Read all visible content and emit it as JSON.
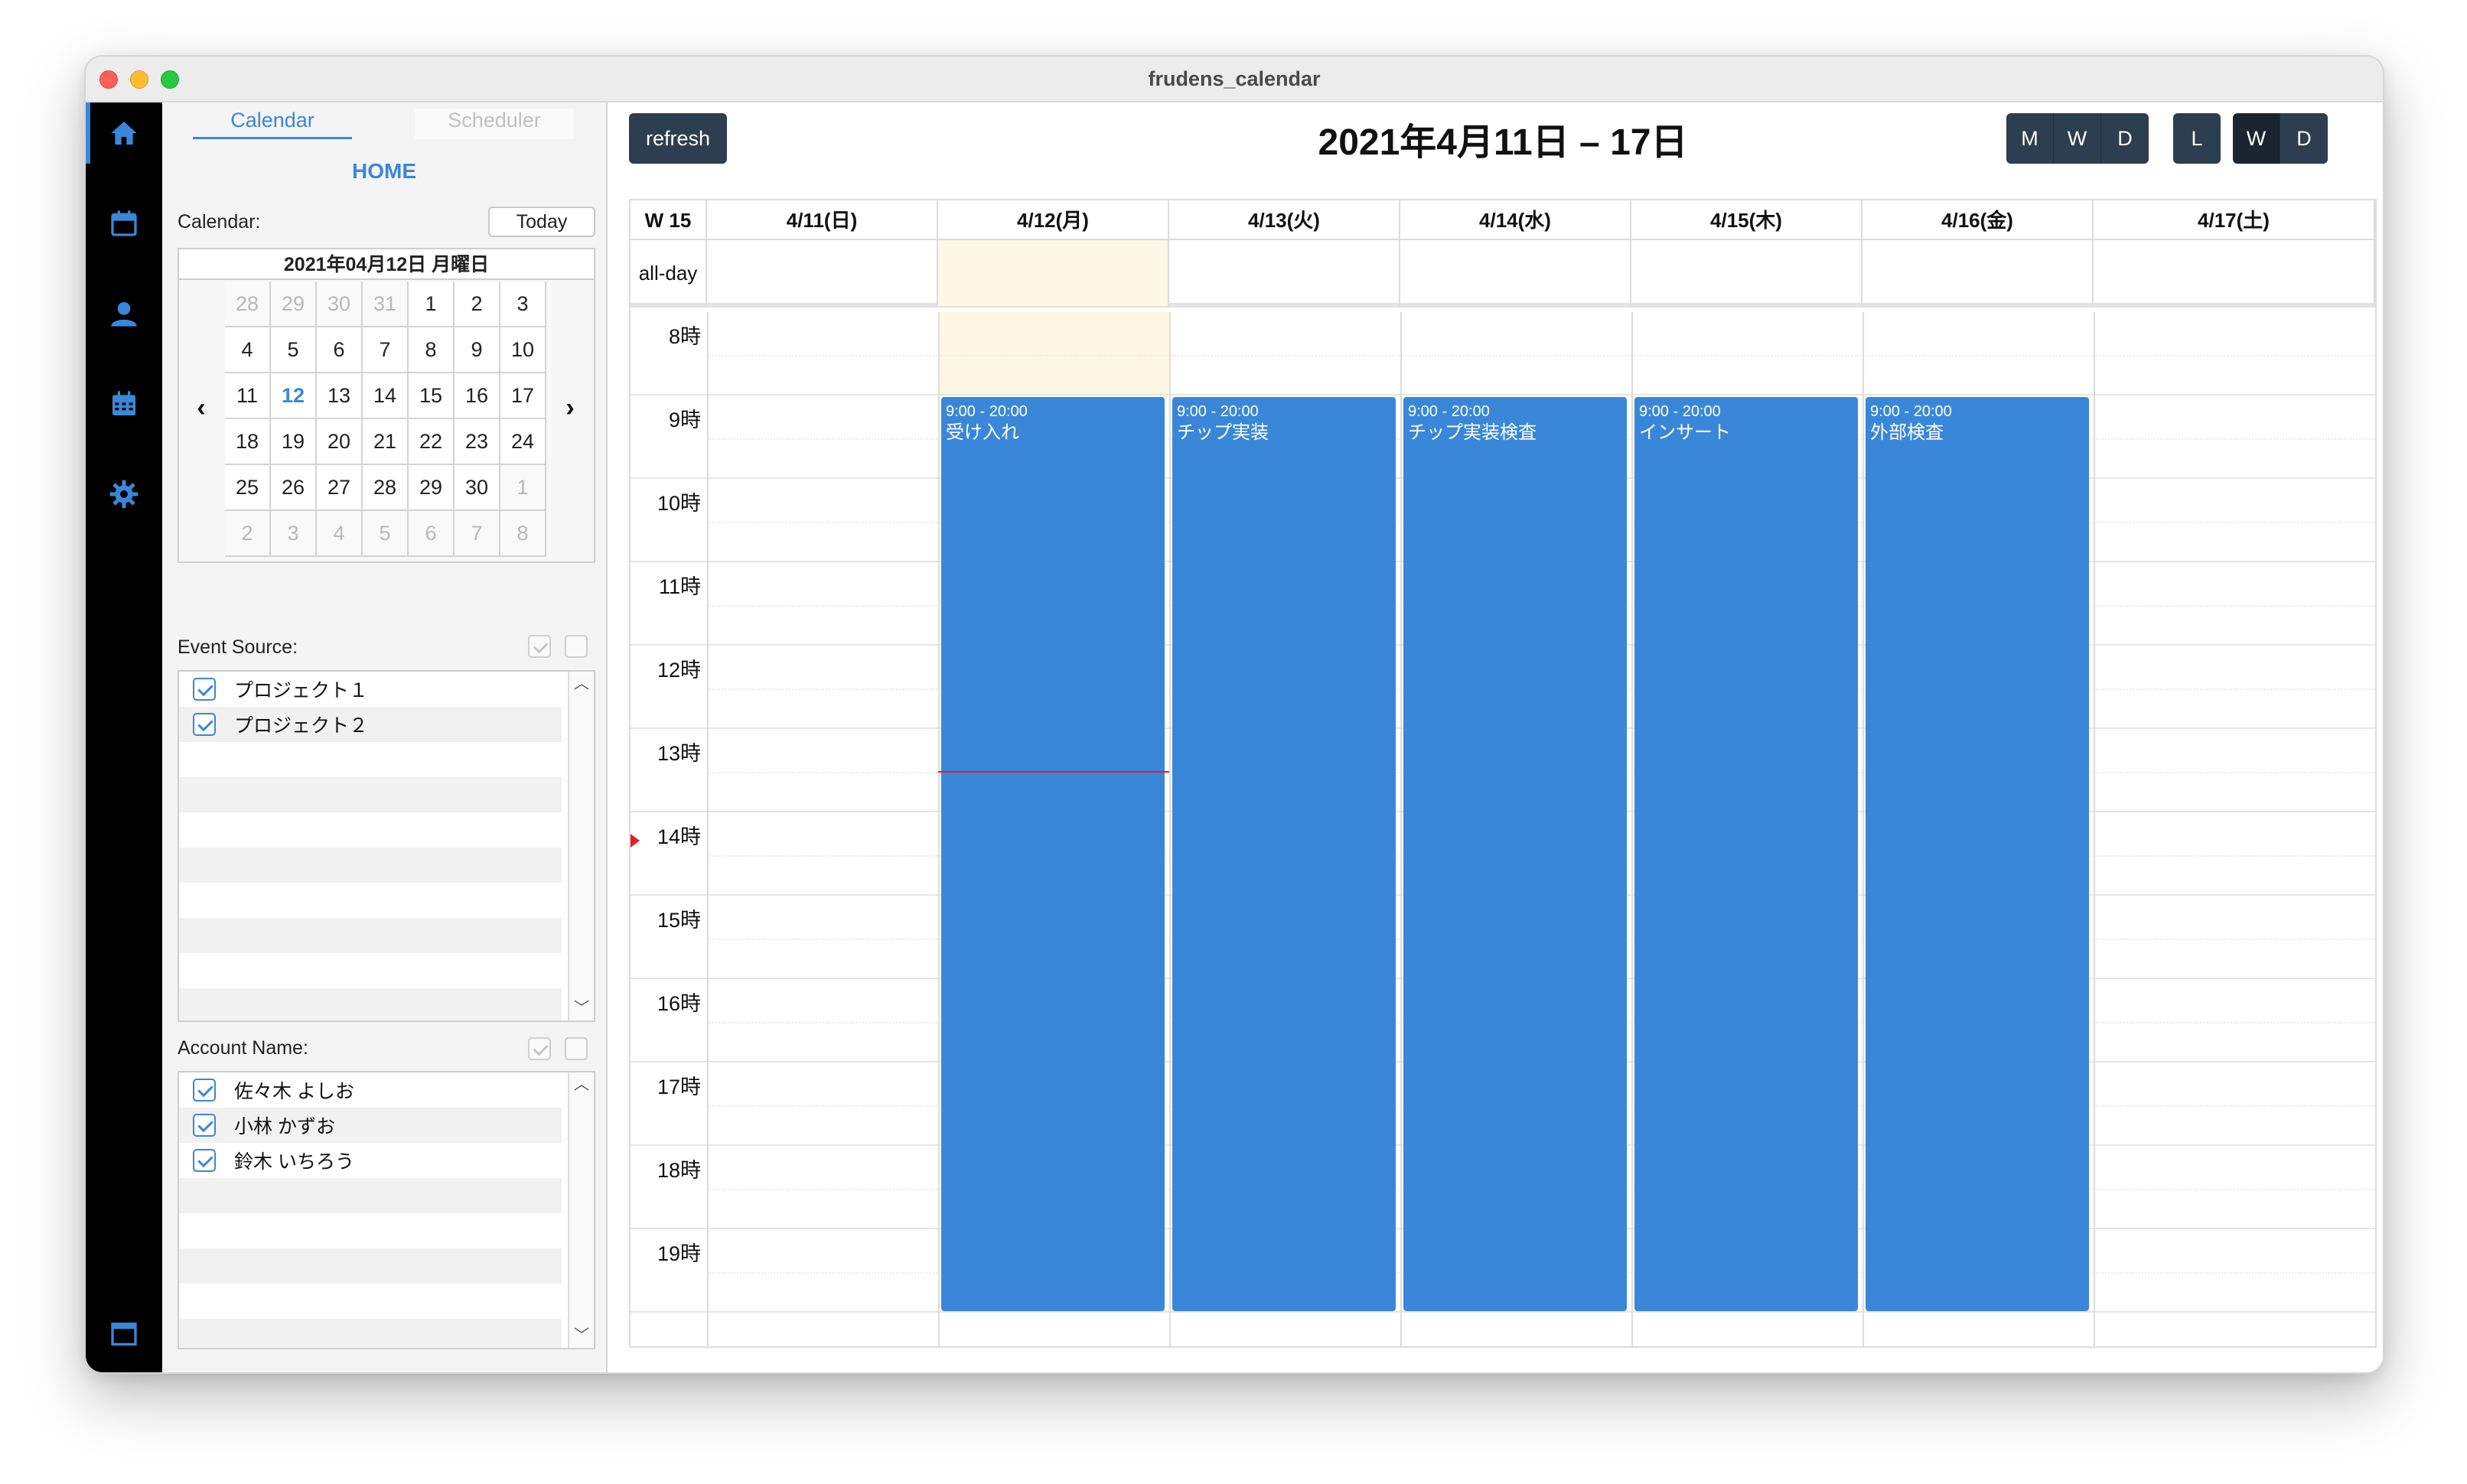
{
  "window": {
    "title": "frudens_calendar"
  },
  "colors": {
    "accent": "#3a87d9",
    "event": "#3a87d9",
    "button": "#2c3e50",
    "today_bg": "#fcf8e3",
    "now_line": "#e02020"
  },
  "rail": {
    "icons": [
      "home-icon",
      "calendar-icon",
      "user-icon",
      "calendar-grid-icon",
      "gear-icon",
      "window-icon"
    ]
  },
  "panel": {
    "tabs": [
      {
        "label": "Calendar"
      },
      {
        "label": "Scheduler"
      }
    ],
    "home_label": "HOME",
    "calendar_label": "Calendar:",
    "today_label": "Today",
    "mini_calendar": {
      "header": "2021年04月12日 月曜日",
      "prev": "‹",
      "next": "›",
      "weeks": [
        [
          "28",
          "29",
          "30",
          "31",
          "1",
          "2",
          "3"
        ],
        [
          "4",
          "5",
          "6",
          "7",
          "8",
          "9",
          "10"
        ],
        [
          "11",
          "12",
          "13",
          "14",
          "15",
          "16",
          "17"
        ],
        [
          "18",
          "19",
          "20",
          "21",
          "22",
          "23",
          "24"
        ],
        [
          "25",
          "26",
          "27",
          "28",
          "29",
          "30",
          "1"
        ],
        [
          "2",
          "3",
          "4",
          "5",
          "6",
          "7",
          "8"
        ]
      ]
    },
    "event_source": {
      "label": "Event Source:",
      "items": [
        "プロジェクト１",
        "プロジェクト２"
      ]
    },
    "account_name": {
      "label": "Account Name:",
      "items": [
        "佐々木 よしお",
        "小林 かずお",
        "鈴木 いちろう"
      ]
    }
  },
  "main": {
    "refresh_label": "refresh",
    "range_title": "2021年4月11日 – 17日",
    "view_group_1": [
      "M",
      "W",
      "D"
    ],
    "view_group_2": [
      "L"
    ],
    "view_group_3": [
      "W",
      "D"
    ],
    "week_label": "W 15",
    "allday_label": "all-day",
    "days": [
      "4/11(日)",
      "4/12(月)",
      "4/13(火)",
      "4/14(水)",
      "4/15(木)",
      "4/16(金)",
      "4/17(土)"
    ],
    "hours": [
      "8時",
      "9時",
      "10時",
      "11時",
      "12時",
      "13時",
      "14時",
      "15時",
      "16時",
      "17時",
      "18時",
      "19時"
    ],
    "events": [
      {
        "day": 1,
        "time": "9:00 - 20:00",
        "title": "受け入れ"
      },
      {
        "day": 2,
        "time": "9:00 - 20:00",
        "title": "チップ実装"
      },
      {
        "day": 3,
        "time": "9:00 - 20:00",
        "title": "チップ実装検査"
      },
      {
        "day": 4,
        "time": "9:00 - 20:00",
        "title": "インサート"
      },
      {
        "day": 5,
        "time": "9:00 - 20:00",
        "title": "外部検査"
      }
    ]
  }
}
